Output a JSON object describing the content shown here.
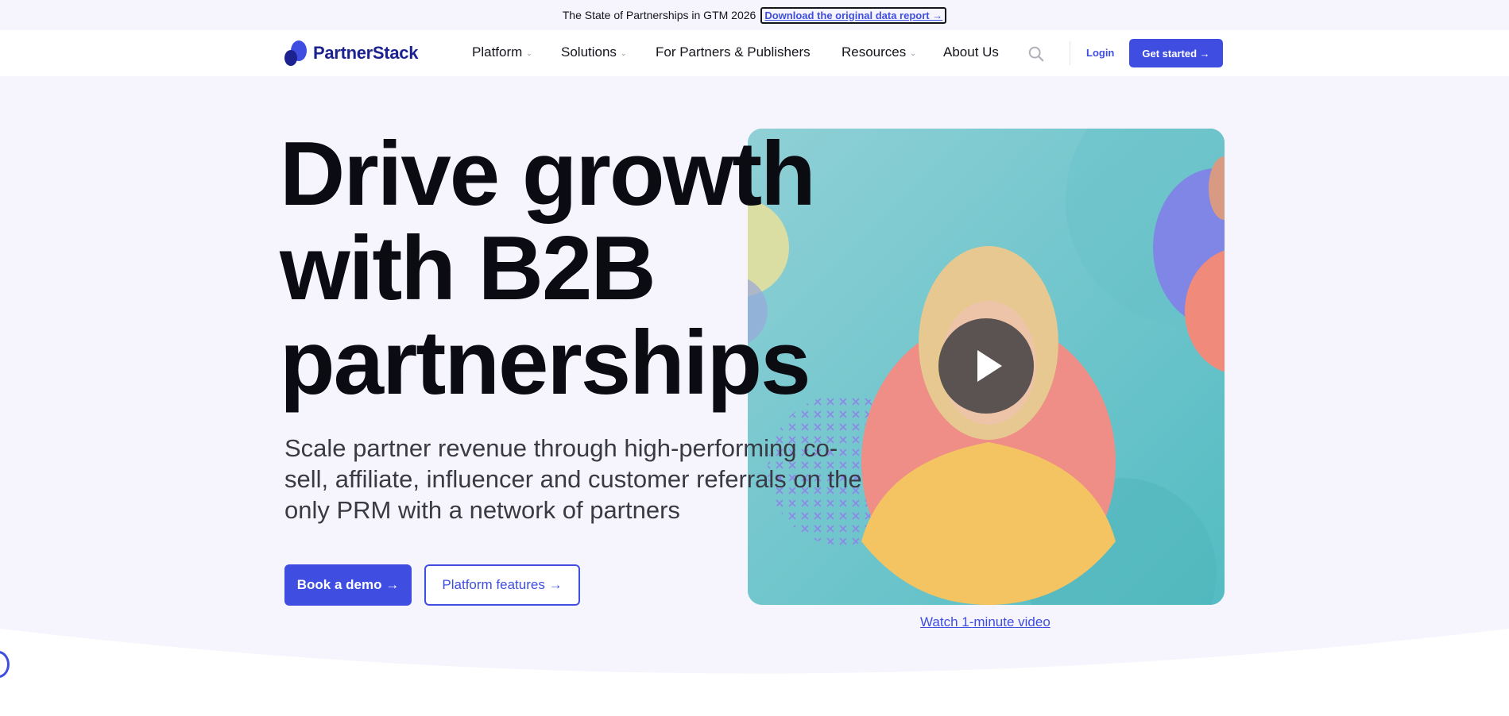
{
  "announcement": {
    "text": "The State of Partnerships in GTM 2026",
    "link_label": "Download the original data report →"
  },
  "nav": {
    "logo_text": "PartnerStack",
    "items": [
      {
        "label": "Platform",
        "has_dropdown": true
      },
      {
        "label": "Solutions",
        "has_dropdown": true
      },
      {
        "label": "For Partners & Publishers",
        "has_dropdown": false
      },
      {
        "label": "Resources",
        "has_dropdown": true
      },
      {
        "label": "About Us",
        "has_dropdown": false
      }
    ],
    "search_icon": "search-icon",
    "login_label": "Login",
    "cta_label": "Get started →"
  },
  "hero": {
    "headline": "Drive growth with B2B partnerships",
    "subheadline": "Scale partner revenue through high-performing co-sell, affiliate, influencer and customer referrals on the only PRM with a network of partners",
    "primary_cta": "Book a demo →",
    "secondary_cta": "Platform features →",
    "video_link": "Watch 1-minute video",
    "play_icon": "play-icon"
  },
  "colors": {
    "brand": "#3f4ee0",
    "brand_dark": "#1c2290",
    "background": "#f6f5fd",
    "video_bg": "#6ec7cb"
  }
}
